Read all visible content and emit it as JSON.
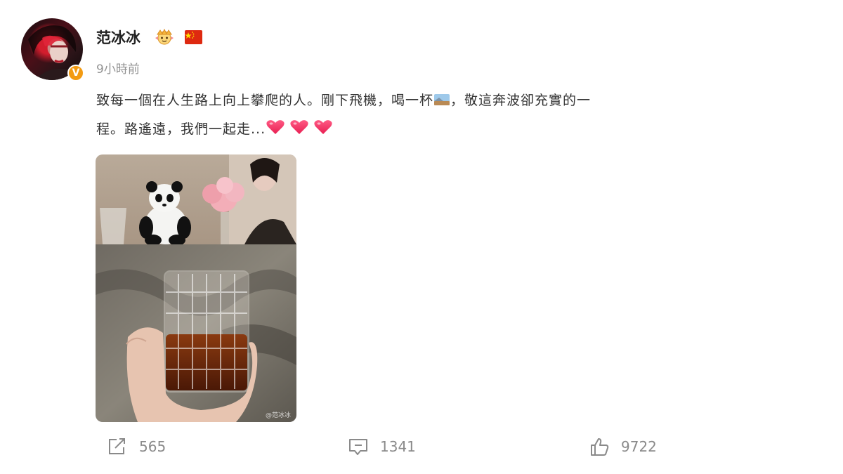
{
  "post": {
    "username": "范冰冰",
    "timestamp": "9小時前",
    "content_line1_a": "致每一個在人生路上向上攀爬的人。剛下飛機，喝一杯",
    "content_line1_b": "，敬這奔波卻充實的一",
    "content_line2": "程。路遙遠，我們一起走...",
    "icons": [
      "vip-crown-icon",
      "china-flag-icon",
      "verified-badge-icon",
      "landscape-emoji-icon",
      "heart-emoji-icon"
    ],
    "verified_color": "#f39b12",
    "image_watermark": "@范冰冰"
  },
  "actions": {
    "repost_count": "565",
    "comment_count": "1341",
    "like_count": "9722"
  }
}
